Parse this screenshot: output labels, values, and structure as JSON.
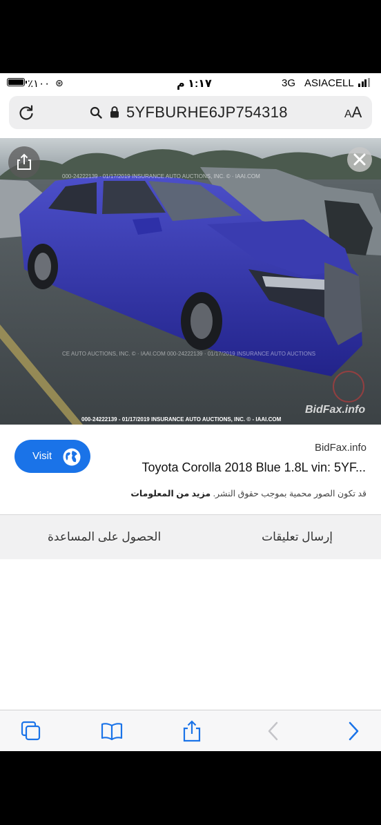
{
  "status": {
    "battery": "٪١٠٠",
    "time": "١:١٧ م",
    "network": "3G",
    "carrier": "ASIACELL"
  },
  "browser": {
    "url": "5YFBURHE6JP754318",
    "text_size_label_small": "A",
    "text_size_label_large": "A"
  },
  "image": {
    "watermark_caption": "000-24222139 - 01/17/2019 INSURANCE AUTO AUCTIONS, INC. © - IAAI.COM",
    "watermark_brand": "BidFax.info"
  },
  "result": {
    "visit_label": "Visit",
    "source": "BidFax.info",
    "title": "Toyota Corolla 2018 Blue 1.8L vin: 5YF...",
    "copyright_note": "قد تكون الصور محمية بموجب حقوق النشر.",
    "more_info": "مزيد من المعلومات"
  },
  "links": {
    "feedback": "إرسال تعليقات",
    "help": "الحصول على المساعدة"
  },
  "colors": {
    "accent": "#1a73e8",
    "toolbar_icon": "#1a73e8"
  }
}
